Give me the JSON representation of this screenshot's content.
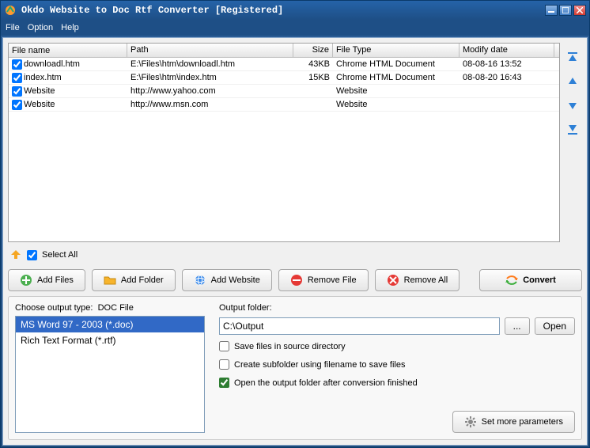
{
  "title": "Okdo Website to Doc Rtf Converter [Registered]",
  "menu": {
    "file": "File",
    "option": "Option",
    "help": "Help"
  },
  "columns": {
    "name": "File name",
    "path": "Path",
    "size": "Size",
    "type": "File Type",
    "date": "Modify date"
  },
  "rows": [
    {
      "checked": true,
      "name": "downloadl.htm",
      "path": "E:\\Files\\htm\\downloadl.htm",
      "size": "43KB",
      "type": "Chrome HTML Document",
      "date": "08-08-16 13:52"
    },
    {
      "checked": true,
      "name": "index.htm",
      "path": "E:\\Files\\htm\\index.htm",
      "size": "15KB",
      "type": "Chrome HTML Document",
      "date": "08-08-20 16:43"
    },
    {
      "checked": true,
      "name": "Website",
      "path": "http://www.yahoo.com",
      "size": "",
      "type": "Website",
      "date": ""
    },
    {
      "checked": true,
      "name": "Website",
      "path": "http://www.msn.com",
      "size": "",
      "type": "Website",
      "date": ""
    }
  ],
  "selectAll": {
    "label": "Select All",
    "checked": true
  },
  "buttons": {
    "addFiles": "Add Files",
    "addFolder": "Add Folder",
    "addWebsite": "Add Website",
    "removeFile": "Remove File",
    "removeAll": "Remove All",
    "convert": "Convert"
  },
  "output": {
    "typeLabelPrefix": "Choose output type:",
    "typeLabelValue": "DOC File",
    "types": [
      {
        "label": "MS Word 97 - 2003 (*.doc)",
        "selected": true
      },
      {
        "label": "Rich Text Format (*.rtf)",
        "selected": false
      }
    ],
    "folderLabel": "Output folder:",
    "folderValue": "C:\\Output",
    "browse": "...",
    "open": "Open",
    "saveInSource": {
      "label": "Save files in source directory",
      "checked": false
    },
    "createSubfolder": {
      "label": "Create subfolder using filename to save files",
      "checked": false
    },
    "openAfter": {
      "label": "Open the output folder after conversion finished",
      "checked": true
    },
    "moreParams": "Set more parameters"
  }
}
